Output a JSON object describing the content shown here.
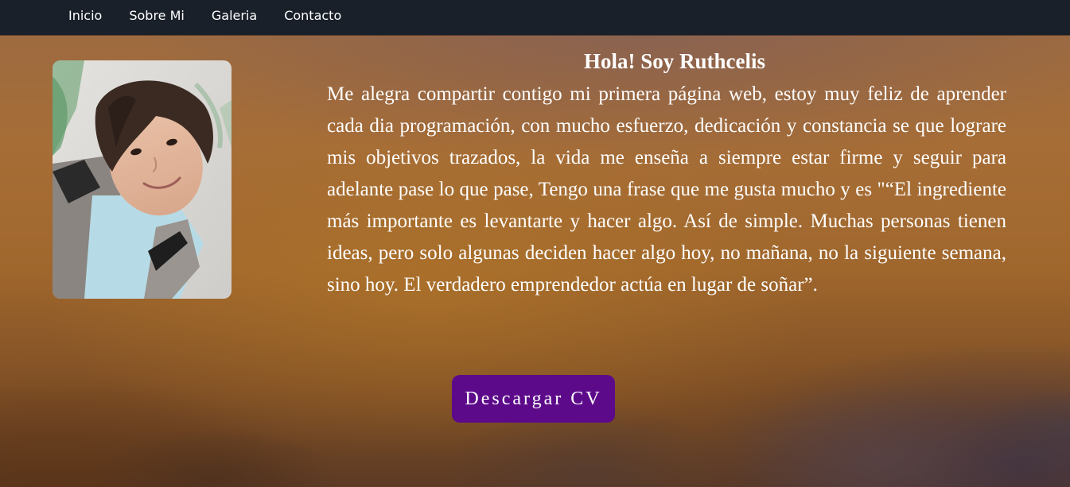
{
  "nav": {
    "items": [
      {
        "label": "Inicio"
      },
      {
        "label": "Sobre Mi"
      },
      {
        "label": "Galeria"
      },
      {
        "label": "Contacto"
      }
    ]
  },
  "profile": {
    "photo_alt": "Foto de Ruthcelis"
  },
  "hero": {
    "title": "Hola! Soy Ruthcelis",
    "bio": "Me alegra compartir contigo mi primera página web, estoy muy feliz de aprender cada dia programación, con mucho esfuerzo, dedicación y constancia se que lograre mis objetivos trazados, la vida me enseña a siempre estar firme y seguir para adelante pase lo que pase, Tengo una frase que me gusta mucho y es \"“El ingrediente más importante es levantarte y hacer algo. Así de simple. Muchas personas tienen ideas, pero solo algunas deciden hacer algo hoy, no mañana, no la siguiente semana, sino hoy. El verdadero emprendedor actúa en lugar de soñar”."
  },
  "cv_button": {
    "label": "Descargar CV"
  },
  "colors": {
    "navbar": "#19202a",
    "button": "#5c0a8a",
    "text": "#ffffff"
  }
}
